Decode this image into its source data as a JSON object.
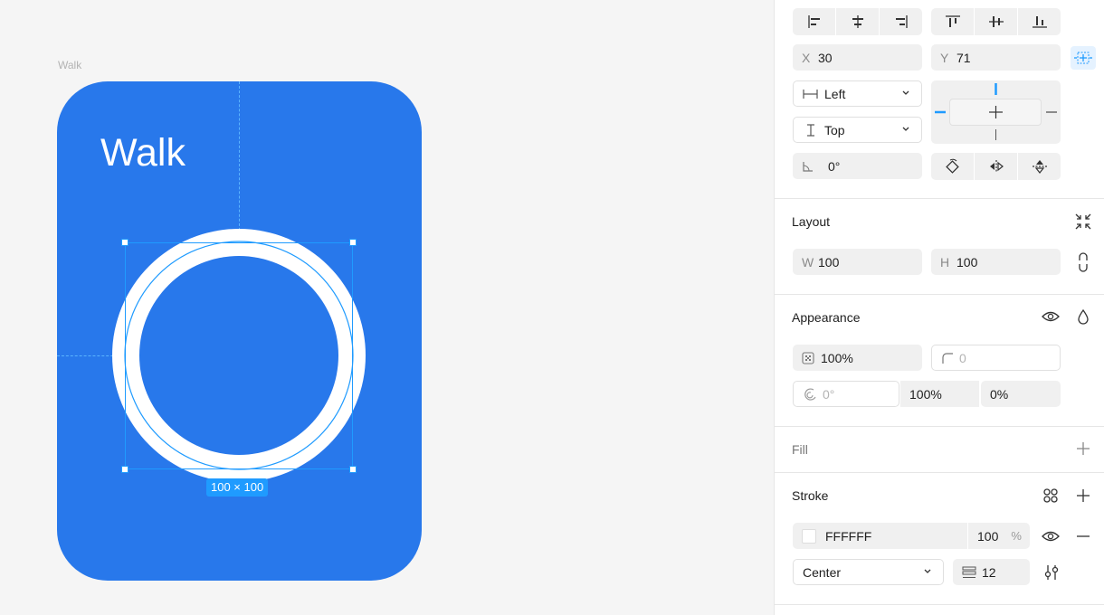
{
  "canvas": {
    "frame_label": "Walk",
    "frame_title": "Walk",
    "size_badge": "100 × 100",
    "frame_color": "#2878EB",
    "selection_color": "#1F9BFF"
  },
  "panel": {
    "position": {
      "x_prefix": "X",
      "x_value": "30",
      "y_prefix": "Y",
      "y_value": "71"
    },
    "constraints": {
      "horizontal": "Left",
      "vertical": "Top"
    },
    "rotation": "0°",
    "layout": {
      "title": "Layout",
      "w_prefix": "W",
      "w_value": "100",
      "h_prefix": "H",
      "h_value": "100"
    },
    "appearance": {
      "title": "Appearance",
      "opacity": "100%",
      "corner_radius": "0",
      "corner_angle": "0°",
      "value_a": "100%",
      "value_b": "0%"
    },
    "fill": {
      "title": "Fill"
    },
    "stroke": {
      "title": "Stroke",
      "color_hex": "FFFFFF",
      "opacity": "100",
      "opacity_unit": "%",
      "position": "Center",
      "weight": "12"
    }
  }
}
